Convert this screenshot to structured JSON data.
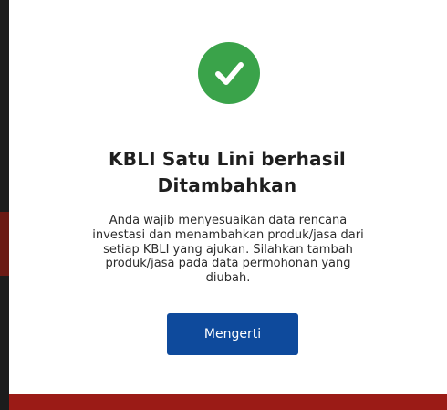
{
  "modal": {
    "title_line1": "KBLI Satu Lini berhasil",
    "title_line2": "Ditambahkan",
    "message_lines": [
      "Anda wajib menyesuaikan data rencana",
      "investasi dan menambahkan produk/jasa dari",
      "setiap KBLI yang ajukan. Silahkan tambah",
      "produk/jasa pada data permohonan yang",
      "diubah."
    ],
    "confirm_label": "Mengerti",
    "icon": "check-circle-icon"
  },
  "colors": {
    "success_green": "#3aa34a",
    "button_blue": "#0e4a9c",
    "backdrop_red": "#9b1b16"
  }
}
